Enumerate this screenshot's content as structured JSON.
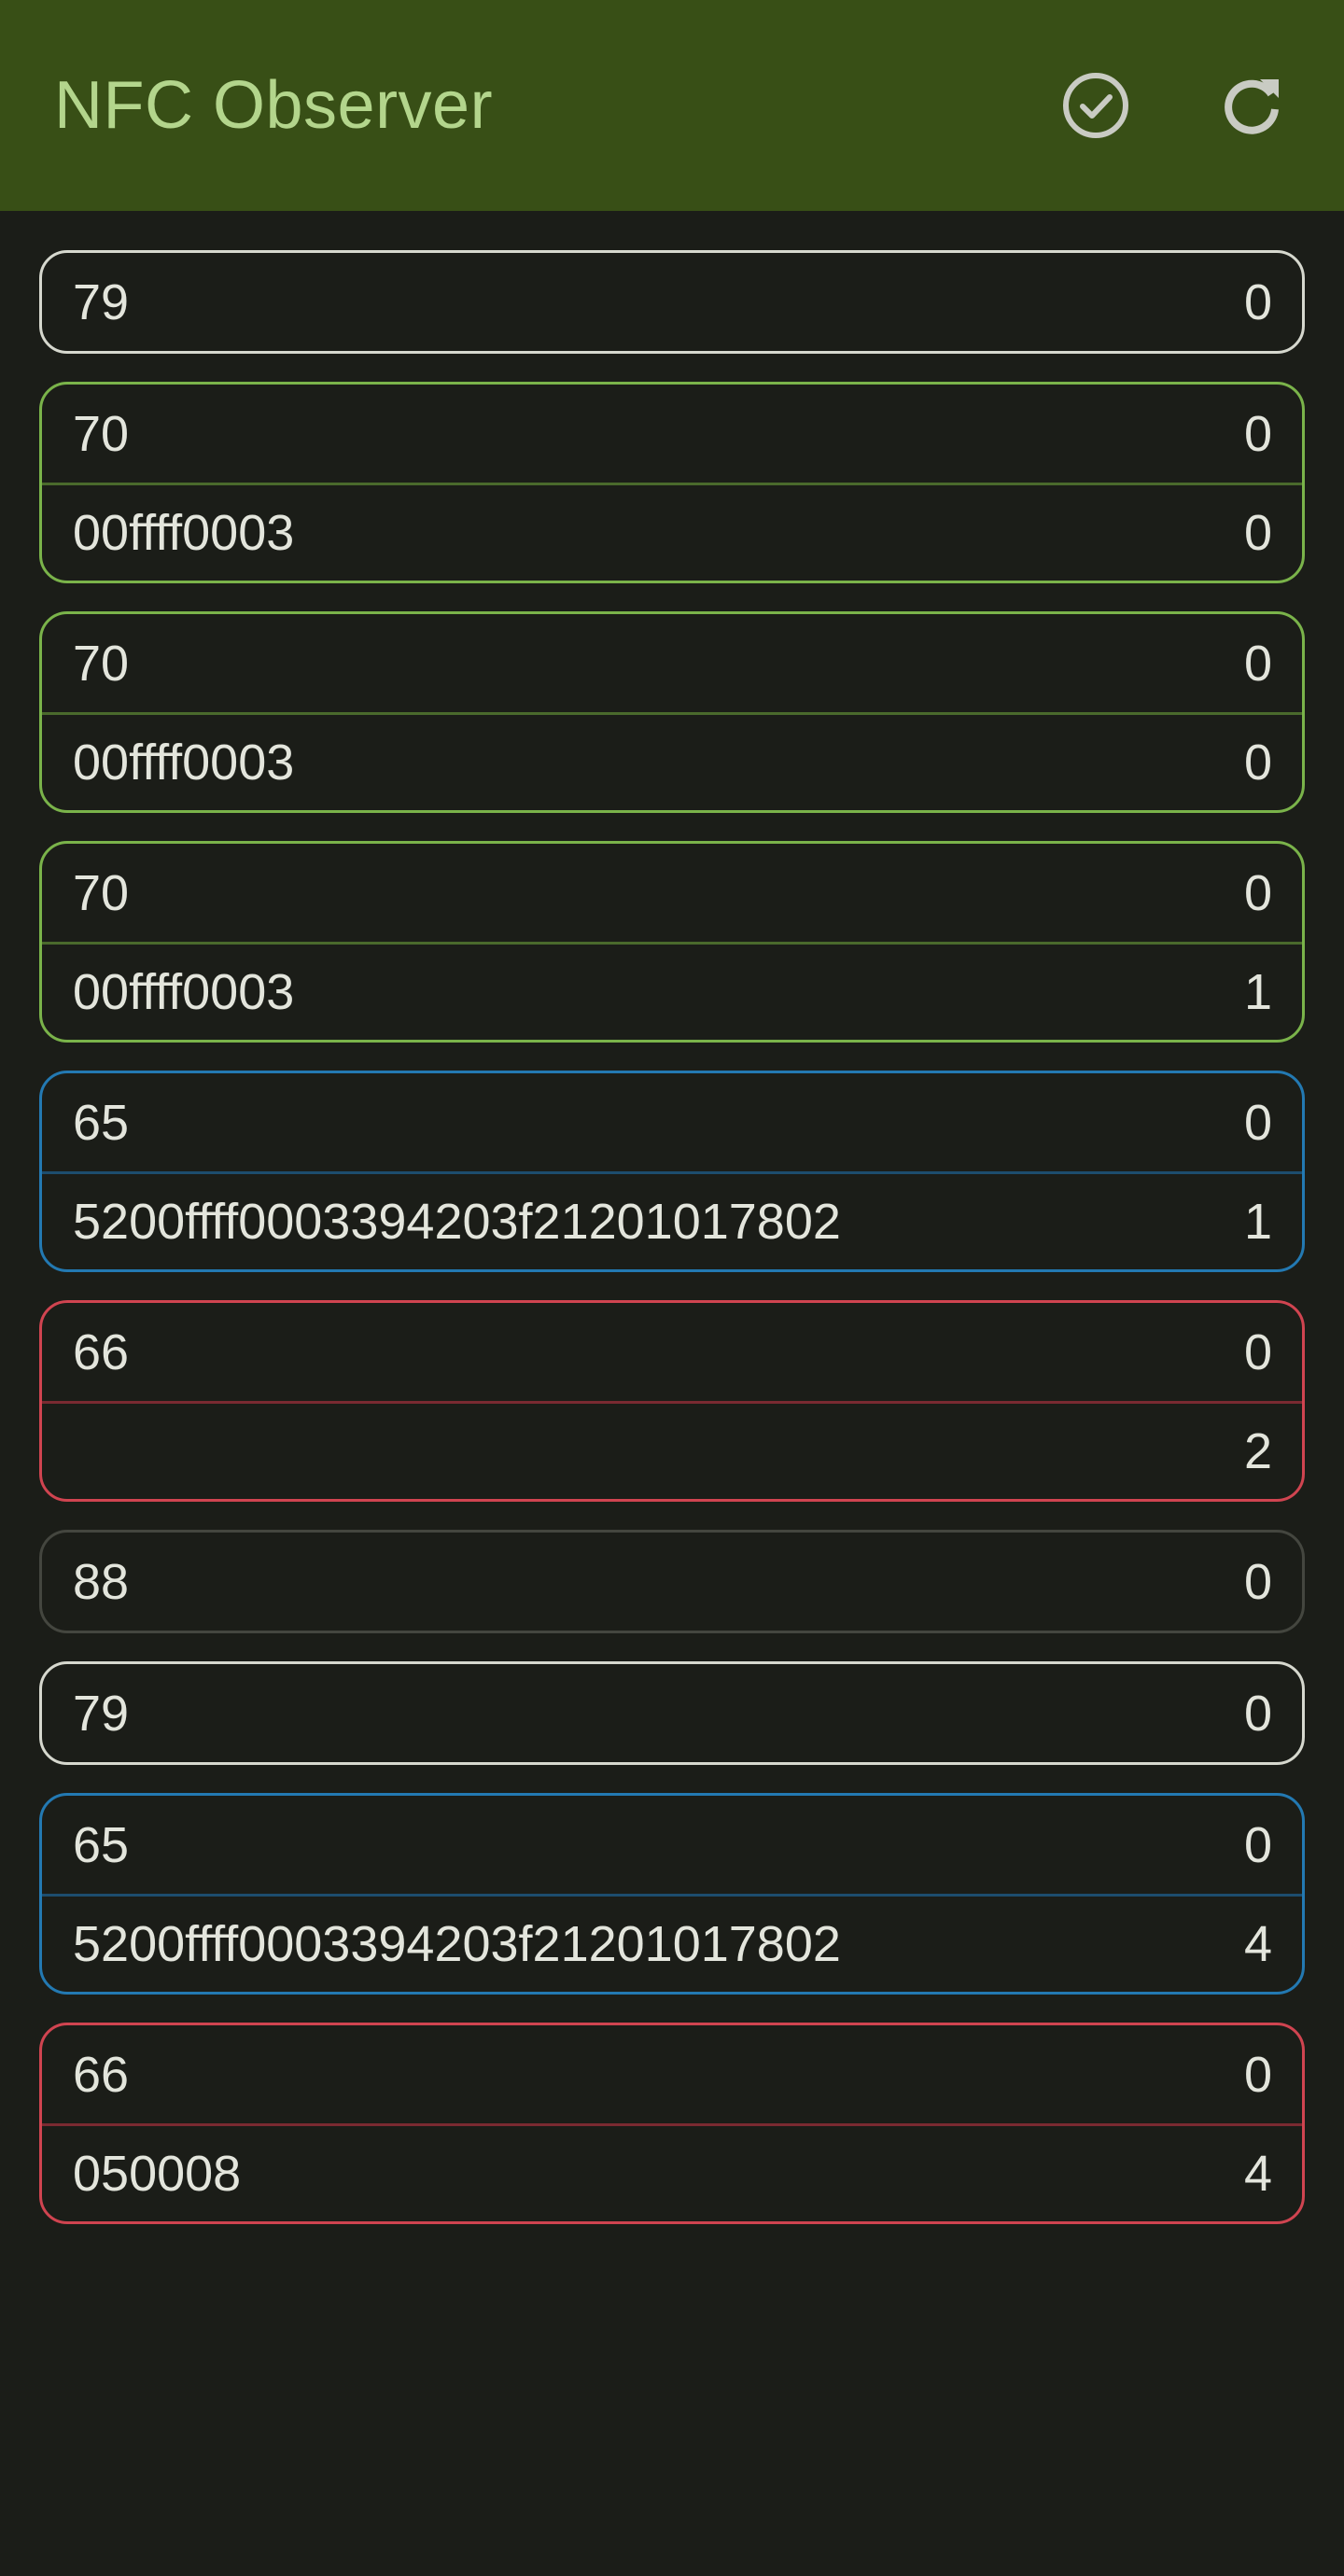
{
  "app_bar": {
    "title": "NFC Observer",
    "icons": [
      "check-circle-icon",
      "refresh-icon"
    ],
    "background": "#384f16",
    "title_color": "#b3d58c"
  },
  "colors": {
    "white": "#d6d8ce",
    "green": "#7ab34a",
    "blue": "#2379b2",
    "red": "#d04450",
    "gray": "#44463f",
    "background": "#1b1d18"
  },
  "cards": [
    {
      "style": "white",
      "rows": [
        {
          "label": "79",
          "value": "0"
        }
      ]
    },
    {
      "style": "green",
      "rows": [
        {
          "label": "70",
          "value": "0"
        },
        {
          "label": "00ffff0003",
          "value": "0"
        }
      ]
    },
    {
      "style": "green",
      "rows": [
        {
          "label": "70",
          "value": "0"
        },
        {
          "label": "00ffff0003",
          "value": "0"
        }
      ]
    },
    {
      "style": "green",
      "rows": [
        {
          "label": "70",
          "value": "0"
        },
        {
          "label": "00ffff0003",
          "value": "1"
        }
      ]
    },
    {
      "style": "blue",
      "rows": [
        {
          "label": "65",
          "value": "0"
        },
        {
          "label": "5200ffff0003394203f21201017802",
          "value": "1"
        }
      ]
    },
    {
      "style": "red",
      "rows": [
        {
          "label": "66",
          "value": "0"
        },
        {
          "label": "",
          "value": "2"
        }
      ]
    },
    {
      "style": "gray",
      "rows": [
        {
          "label": "88",
          "value": "0"
        }
      ]
    },
    {
      "style": "white",
      "rows": [
        {
          "label": "79",
          "value": "0"
        }
      ]
    },
    {
      "style": "blue",
      "rows": [
        {
          "label": "65",
          "value": "0"
        },
        {
          "label": "5200ffff0003394203f21201017802",
          "value": "4"
        }
      ]
    },
    {
      "style": "red",
      "rows": [
        {
          "label": "66",
          "value": "0"
        },
        {
          "label": "050008",
          "value": "4"
        }
      ]
    }
  ]
}
